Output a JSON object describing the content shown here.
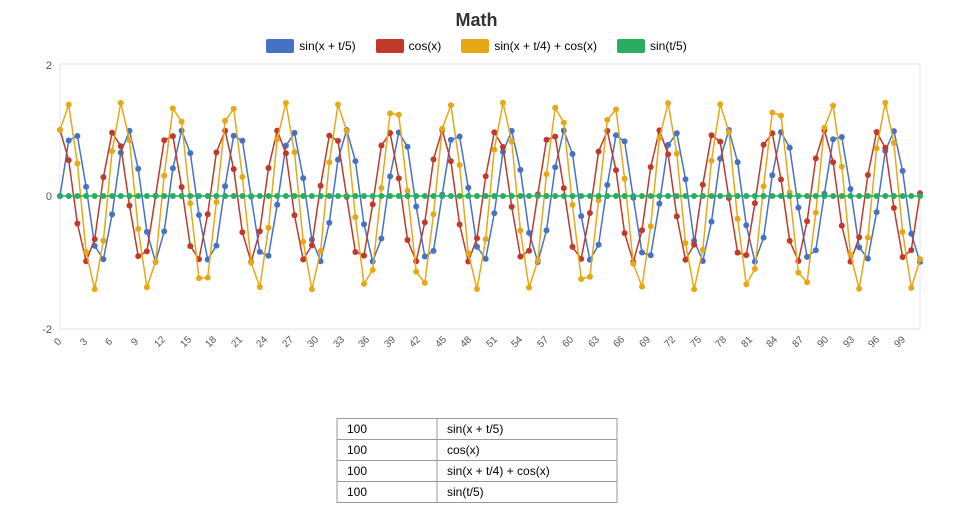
{
  "title": "Math",
  "legend": [
    {
      "label": "sin(x + t/5)",
      "color": "#4472C4"
    },
    {
      "label": "cos(x)",
      "color": "#C0392B"
    },
    {
      "label": "sin(x + t/4) + cos(x)",
      "color": "#E6A817"
    },
    {
      "label": "sin(t/5)",
      "color": "#27AE60"
    }
  ],
  "yAxis": {
    "max": 2,
    "min": -2,
    "ticks": [
      2,
      0,
      -2
    ]
  },
  "xAxis": {
    "ticks": [
      "0",
      "3",
      "6",
      "9",
      "12",
      "15",
      "18",
      "21",
      "24",
      "27",
      "30",
      "33",
      "36",
      "39",
      "42",
      "45",
      "48",
      "51",
      "54",
      "57",
      "60",
      "63",
      "66",
      "69",
      "72",
      "75",
      "78",
      "81",
      "84",
      "87",
      "90",
      "93",
      "96",
      "99"
    ]
  },
  "table": [
    {
      "count": "100",
      "formula": "sin(x + t/5)"
    },
    {
      "count": "100",
      "formula": "cos(x)"
    },
    {
      "count": "100",
      "formula": "sin(x + t/4) + cos(x)"
    },
    {
      "count": "100",
      "formula": "sin(t/5)"
    }
  ]
}
